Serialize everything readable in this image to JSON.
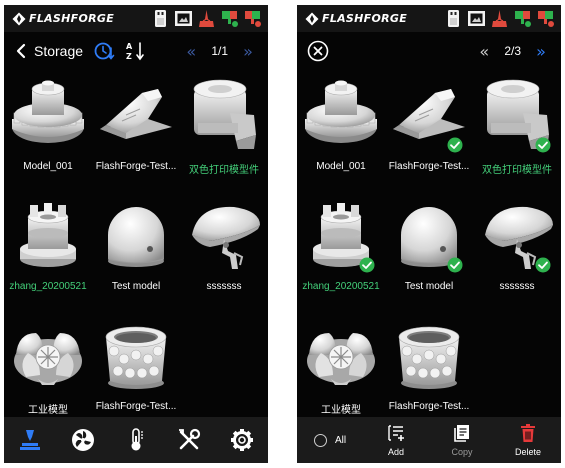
{
  "brand": {
    "name": "FLASHFORGE"
  },
  "colors": {
    "accent_blue": "#2f7cf6",
    "pager_dim": "#3c5aa0",
    "green_highlight": "#44d07a",
    "delete_red": "#e5393a",
    "check_green": "#2eb24e"
  },
  "status_icons": [
    "usb-icon",
    "camera-icon",
    "nozzle-temp-icon",
    "left-extruder-temp-icon",
    "right-extruder-temp-icon"
  ],
  "left": {
    "nav": {
      "title": "Storage",
      "page": "1/1",
      "icons": [
        "back-arrow-icon",
        "clock-sort-icon",
        "alpha-sort-icon",
        "prev-page-icon",
        "next-page-icon"
      ]
    },
    "files": [
      {
        "name": "Model_001",
        "highlight": false,
        "thumb": "gear-model"
      },
      {
        "name": "FlashForge-Test...",
        "highlight": false,
        "thumb": "wedge-model"
      },
      {
        "name": "双色打印模型件",
        "highlight": true,
        "thumb": "bracket-model"
      },
      {
        "name": "zhang_20200521",
        "highlight": true,
        "thumb": "castle-model"
      },
      {
        "name": "Test model",
        "highlight": false,
        "thumb": "dome-model"
      },
      {
        "name": "sssssss",
        "highlight": false,
        "thumb": "helmet-model"
      },
      {
        "name": "工业模型",
        "highlight": false,
        "thumb": "flower-model"
      },
      {
        "name": "FlashForge-Test...",
        "highlight": false,
        "thumb": "vase-model"
      }
    ],
    "tabs": [
      "print-head-tab-icon",
      "fan-tab-icon",
      "thermometer-tab-icon",
      "tools-tab-icon",
      "settings-tab-icon"
    ]
  },
  "right": {
    "nav": {
      "page": "2/3",
      "icons": [
        "close-icon",
        "prev-page-icon",
        "next-page-icon"
      ]
    },
    "files": [
      {
        "name": "Model_001",
        "highlight": false,
        "selected": false
      },
      {
        "name": "FlashForge-Test...",
        "highlight": false,
        "selected": true
      },
      {
        "name": "双色打印模型件",
        "highlight": true,
        "selected": true
      },
      {
        "name": "zhang_20200521",
        "highlight": true,
        "selected": true
      },
      {
        "name": "Test model",
        "highlight": false,
        "selected": true
      },
      {
        "name": "sssssss",
        "highlight": false,
        "selected": true
      },
      {
        "name": "工业模型",
        "highlight": false,
        "selected": false
      },
      {
        "name": "FlashForge-Test...",
        "highlight": false,
        "selected": false
      }
    ],
    "actions": {
      "select_all": "All",
      "add": "Add",
      "copy": "Copy",
      "delete": "Delete"
    }
  }
}
